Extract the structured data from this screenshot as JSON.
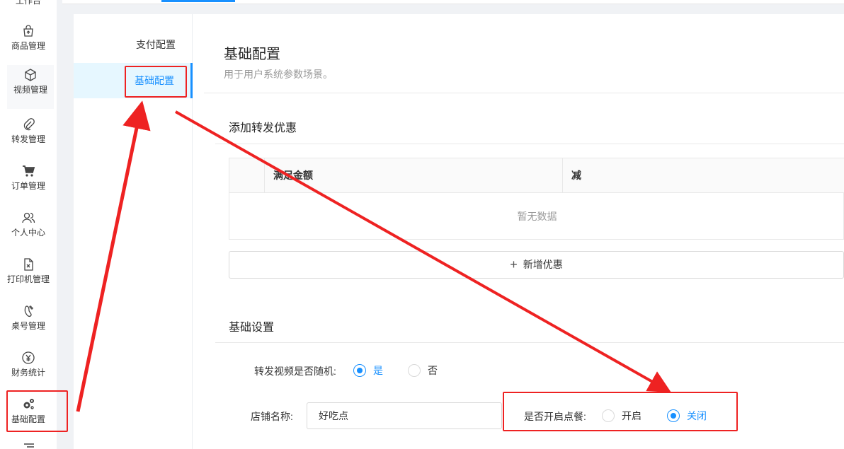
{
  "nav": {
    "top_label": "工作台",
    "items": [
      {
        "label": "商品管理",
        "icon": "shopping-bag-icon"
      },
      {
        "label": "视频管理",
        "icon": "cube-icon"
      },
      {
        "label": "转发管理",
        "icon": "paperclip-icon"
      },
      {
        "label": "订单管理",
        "icon": "cart-icon"
      },
      {
        "label": "个人中心",
        "icon": "users-icon"
      },
      {
        "label": "打印机管理",
        "icon": "file-x-icon"
      },
      {
        "label": "桌号管理",
        "icon": "footprint-icon"
      },
      {
        "label": "财务统计",
        "icon": "yuan-circle-icon"
      },
      {
        "label": "基础配置",
        "icon": "gears-icon"
      }
    ]
  },
  "subnav": {
    "items": [
      {
        "label": "支付配置",
        "active": false
      },
      {
        "label": "基础配置",
        "active": true
      }
    ]
  },
  "page": {
    "title": "基础配置",
    "description": "用于用户系统参数场景。"
  },
  "discount": {
    "section_title": "添加转发优惠",
    "columns": [
      "满足金额",
      "减"
    ],
    "empty_text": "暂无数据",
    "add_label": "新增优惠"
  },
  "settings": {
    "section_title": "基础设置",
    "random_video": {
      "label": "转发视频是否随机:",
      "options": [
        "是",
        "否"
      ],
      "selected": "是"
    },
    "shop_name": {
      "label": "店铺名称:",
      "value": "好吃点"
    },
    "ordering": {
      "label": "是否开启点餐:",
      "options": [
        "开启",
        "关闭"
      ],
      "selected": "关闭"
    }
  },
  "colors": {
    "primary": "#1890ff",
    "annotation": "#ee2222"
  }
}
